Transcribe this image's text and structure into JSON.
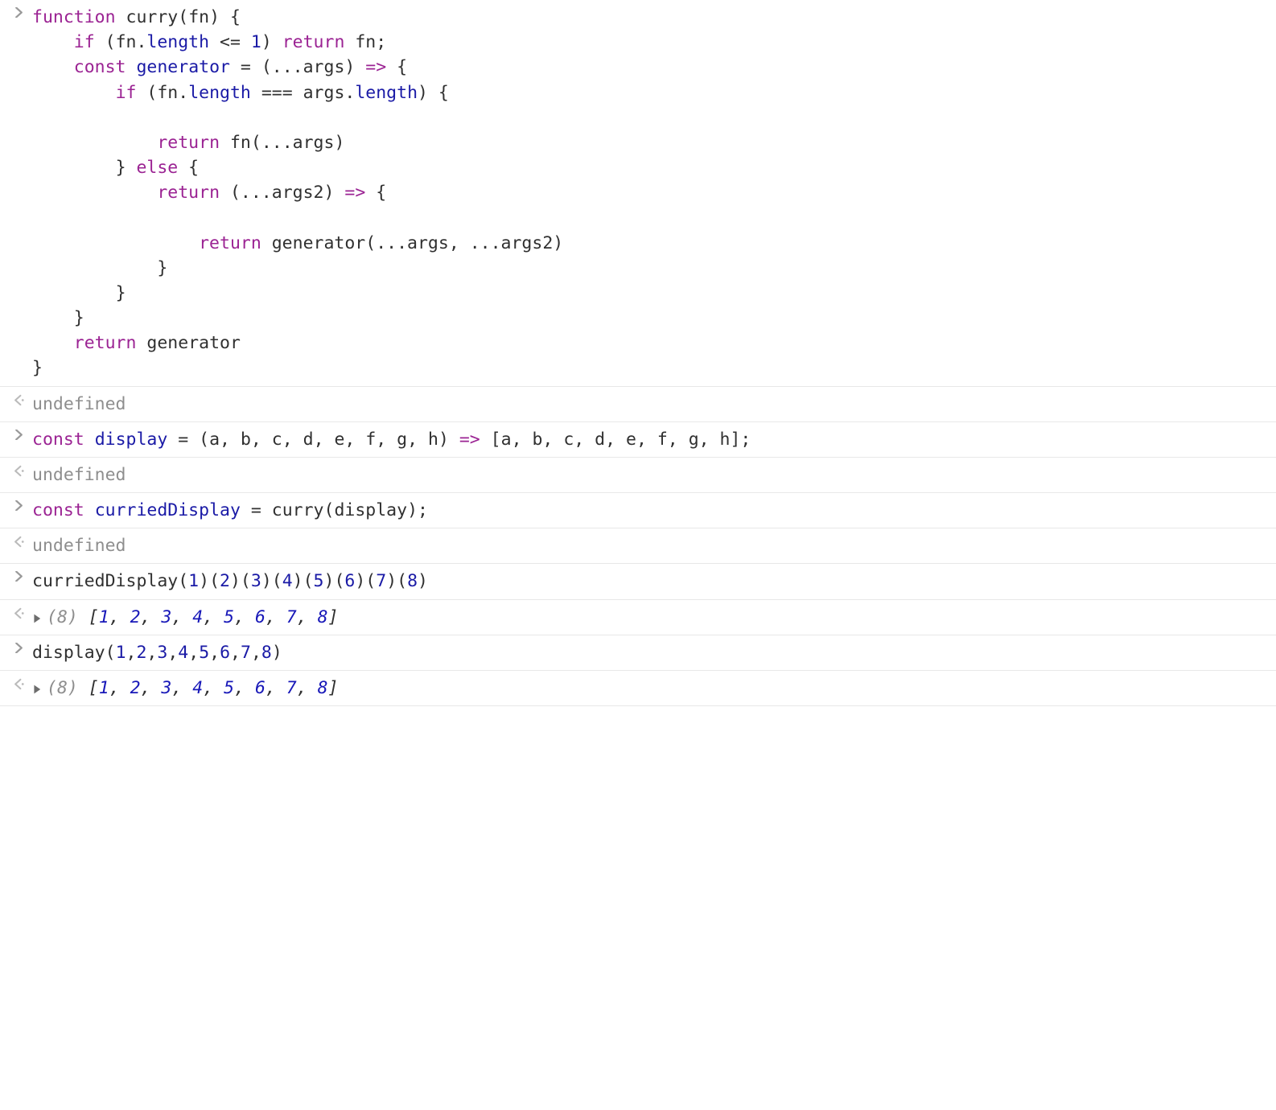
{
  "colors": {
    "keyword": "#9b2393",
    "identifier": "#303030",
    "declared": "#1a1aa6",
    "property": "#1a1aa6",
    "number": "#1a1aa6",
    "undefined": "#8e8e8e"
  },
  "entries": [
    {
      "type": "input",
      "tokens": [
        {
          "t": "kw",
          "v": "function"
        },
        {
          "t": "punc",
          "v": " "
        },
        {
          "t": "fname",
          "v": "curry"
        },
        {
          "t": "punc",
          "v": "("
        },
        {
          "t": "ident",
          "v": "fn"
        },
        {
          "t": "punc",
          "v": ") {"
        },
        {
          "t": "nl"
        },
        {
          "t": "punc",
          "v": "    "
        },
        {
          "t": "kw",
          "v": "if"
        },
        {
          "t": "punc",
          "v": " ("
        },
        {
          "t": "ident",
          "v": "fn"
        },
        {
          "t": "punc",
          "v": "."
        },
        {
          "t": "prop",
          "v": "length"
        },
        {
          "t": "punc",
          "v": " "
        },
        {
          "t": "op",
          "v": "<="
        },
        {
          "t": "punc",
          "v": " "
        },
        {
          "t": "num",
          "v": "1"
        },
        {
          "t": "punc",
          "v": ") "
        },
        {
          "t": "kw",
          "v": "return"
        },
        {
          "t": "punc",
          "v": " "
        },
        {
          "t": "ident",
          "v": "fn"
        },
        {
          "t": "punc",
          "v": ";"
        },
        {
          "t": "nl"
        },
        {
          "t": "punc",
          "v": "    "
        },
        {
          "t": "kw",
          "v": "const"
        },
        {
          "t": "punc",
          "v": " "
        },
        {
          "t": "decl",
          "v": "generator"
        },
        {
          "t": "punc",
          "v": " "
        },
        {
          "t": "op",
          "v": "="
        },
        {
          "t": "punc",
          "v": " ("
        },
        {
          "t": "spread",
          "v": "..."
        },
        {
          "t": "ident",
          "v": "args"
        },
        {
          "t": "punc",
          "v": ") "
        },
        {
          "t": "arrow",
          "v": "=>"
        },
        {
          "t": "punc",
          "v": " {"
        },
        {
          "t": "nl"
        },
        {
          "t": "punc",
          "v": "        "
        },
        {
          "t": "kw",
          "v": "if"
        },
        {
          "t": "punc",
          "v": " ("
        },
        {
          "t": "ident",
          "v": "fn"
        },
        {
          "t": "punc",
          "v": "."
        },
        {
          "t": "prop",
          "v": "length"
        },
        {
          "t": "punc",
          "v": " "
        },
        {
          "t": "op",
          "v": "==="
        },
        {
          "t": "punc",
          "v": " "
        },
        {
          "t": "ident",
          "v": "args"
        },
        {
          "t": "punc",
          "v": "."
        },
        {
          "t": "prop",
          "v": "length"
        },
        {
          "t": "punc",
          "v": ") {"
        },
        {
          "t": "nl"
        },
        {
          "t": "nl"
        },
        {
          "t": "punc",
          "v": "            "
        },
        {
          "t": "kw",
          "v": "return"
        },
        {
          "t": "punc",
          "v": " "
        },
        {
          "t": "ident",
          "v": "fn"
        },
        {
          "t": "punc",
          "v": "("
        },
        {
          "t": "spread",
          "v": "..."
        },
        {
          "t": "ident",
          "v": "args"
        },
        {
          "t": "punc",
          "v": ")"
        },
        {
          "t": "nl"
        },
        {
          "t": "punc",
          "v": "        } "
        },
        {
          "t": "kw",
          "v": "else"
        },
        {
          "t": "punc",
          "v": " {"
        },
        {
          "t": "nl"
        },
        {
          "t": "punc",
          "v": "            "
        },
        {
          "t": "kw",
          "v": "return"
        },
        {
          "t": "punc",
          "v": " ("
        },
        {
          "t": "spread",
          "v": "..."
        },
        {
          "t": "ident",
          "v": "args2"
        },
        {
          "t": "punc",
          "v": ") "
        },
        {
          "t": "arrow",
          "v": "=>"
        },
        {
          "t": "punc",
          "v": " {"
        },
        {
          "t": "nl"
        },
        {
          "t": "nl"
        },
        {
          "t": "punc",
          "v": "                "
        },
        {
          "t": "kw",
          "v": "return"
        },
        {
          "t": "punc",
          "v": " "
        },
        {
          "t": "ident",
          "v": "generator"
        },
        {
          "t": "punc",
          "v": "("
        },
        {
          "t": "spread",
          "v": "..."
        },
        {
          "t": "ident",
          "v": "args"
        },
        {
          "t": "punc",
          "v": ", "
        },
        {
          "t": "spread",
          "v": "..."
        },
        {
          "t": "ident",
          "v": "args2"
        },
        {
          "t": "punc",
          "v": ")"
        },
        {
          "t": "nl"
        },
        {
          "t": "punc",
          "v": "            }"
        },
        {
          "t": "nl"
        },
        {
          "t": "punc",
          "v": "        }"
        },
        {
          "t": "nl"
        },
        {
          "t": "punc",
          "v": "    }"
        },
        {
          "t": "nl"
        },
        {
          "t": "punc",
          "v": "    "
        },
        {
          "t": "kw",
          "v": "return"
        },
        {
          "t": "punc",
          "v": " "
        },
        {
          "t": "ident",
          "v": "generator"
        },
        {
          "t": "nl"
        },
        {
          "t": "punc",
          "v": "}"
        }
      ]
    },
    {
      "type": "result",
      "undefined": true,
      "text": "undefined"
    },
    {
      "type": "input",
      "tokens": [
        {
          "t": "kw",
          "v": "const"
        },
        {
          "t": "punc",
          "v": " "
        },
        {
          "t": "decl",
          "v": "display"
        },
        {
          "t": "punc",
          "v": " "
        },
        {
          "t": "op",
          "v": "="
        },
        {
          "t": "punc",
          "v": " ("
        },
        {
          "t": "ident",
          "v": "a"
        },
        {
          "t": "punc",
          "v": ", "
        },
        {
          "t": "ident",
          "v": "b"
        },
        {
          "t": "punc",
          "v": ", "
        },
        {
          "t": "ident",
          "v": "c"
        },
        {
          "t": "punc",
          "v": ", "
        },
        {
          "t": "ident",
          "v": "d"
        },
        {
          "t": "punc",
          "v": ", "
        },
        {
          "t": "ident",
          "v": "e"
        },
        {
          "t": "punc",
          "v": ", "
        },
        {
          "t": "ident",
          "v": "f"
        },
        {
          "t": "punc",
          "v": ", "
        },
        {
          "t": "ident",
          "v": "g"
        },
        {
          "t": "punc",
          "v": ", "
        },
        {
          "t": "ident",
          "v": "h"
        },
        {
          "t": "punc",
          "v": ") "
        },
        {
          "t": "arrow",
          "v": "=>"
        },
        {
          "t": "punc",
          "v": " ["
        },
        {
          "t": "ident",
          "v": "a"
        },
        {
          "t": "punc",
          "v": ", "
        },
        {
          "t": "ident",
          "v": "b"
        },
        {
          "t": "punc",
          "v": ", "
        },
        {
          "t": "ident",
          "v": "c"
        },
        {
          "t": "punc",
          "v": ", "
        },
        {
          "t": "ident",
          "v": "d"
        },
        {
          "t": "punc",
          "v": ", "
        },
        {
          "t": "ident",
          "v": "e"
        },
        {
          "t": "punc",
          "v": ", "
        },
        {
          "t": "ident",
          "v": "f"
        },
        {
          "t": "punc",
          "v": ", "
        },
        {
          "t": "ident",
          "v": "g"
        },
        {
          "t": "punc",
          "v": ", "
        },
        {
          "t": "ident",
          "v": "h"
        },
        {
          "t": "punc",
          "v": "];"
        }
      ]
    },
    {
      "type": "result",
      "undefined": true,
      "text": "undefined"
    },
    {
      "type": "input",
      "tokens": [
        {
          "t": "kw",
          "v": "const"
        },
        {
          "t": "punc",
          "v": " "
        },
        {
          "t": "decl",
          "v": "curriedDisplay"
        },
        {
          "t": "punc",
          "v": " "
        },
        {
          "t": "op",
          "v": "="
        },
        {
          "t": "punc",
          "v": " "
        },
        {
          "t": "ident",
          "v": "curry"
        },
        {
          "t": "punc",
          "v": "("
        },
        {
          "t": "ident",
          "v": "display"
        },
        {
          "t": "punc",
          "v": ");"
        }
      ]
    },
    {
      "type": "result",
      "undefined": true,
      "text": "undefined"
    },
    {
      "type": "input",
      "tokens": [
        {
          "t": "ident",
          "v": "curriedDisplay"
        },
        {
          "t": "punc",
          "v": "("
        },
        {
          "t": "num",
          "v": "1"
        },
        {
          "t": "punc",
          "v": ")("
        },
        {
          "t": "num",
          "v": "2"
        },
        {
          "t": "punc",
          "v": ")("
        },
        {
          "t": "num",
          "v": "3"
        },
        {
          "t": "punc",
          "v": ")("
        },
        {
          "t": "num",
          "v": "4"
        },
        {
          "t": "punc",
          "v": ")("
        },
        {
          "t": "num",
          "v": "5"
        },
        {
          "t": "punc",
          "v": ")("
        },
        {
          "t": "num",
          "v": "6"
        },
        {
          "t": "punc",
          "v": ")("
        },
        {
          "t": "num",
          "v": "7"
        },
        {
          "t": "punc",
          "v": ")("
        },
        {
          "t": "num",
          "v": "8"
        },
        {
          "t": "punc",
          "v": ")"
        }
      ]
    },
    {
      "type": "result",
      "array": {
        "length": 8,
        "values": [
          1,
          2,
          3,
          4,
          5,
          6,
          7,
          8
        ]
      }
    },
    {
      "type": "input",
      "tokens": [
        {
          "t": "ident",
          "v": "display"
        },
        {
          "t": "punc",
          "v": "("
        },
        {
          "t": "num",
          "v": "1"
        },
        {
          "t": "punc",
          "v": ","
        },
        {
          "t": "num",
          "v": "2"
        },
        {
          "t": "punc",
          "v": ","
        },
        {
          "t": "num",
          "v": "3"
        },
        {
          "t": "punc",
          "v": ","
        },
        {
          "t": "num",
          "v": "4"
        },
        {
          "t": "punc",
          "v": ","
        },
        {
          "t": "num",
          "v": "5"
        },
        {
          "t": "punc",
          "v": ","
        },
        {
          "t": "num",
          "v": "6"
        },
        {
          "t": "punc",
          "v": ","
        },
        {
          "t": "num",
          "v": "7"
        },
        {
          "t": "punc",
          "v": ","
        },
        {
          "t": "num",
          "v": "8"
        },
        {
          "t": "punc",
          "v": ")"
        }
      ]
    },
    {
      "type": "result",
      "array": {
        "length": 8,
        "values": [
          1,
          2,
          3,
          4,
          5,
          6,
          7,
          8
        ]
      }
    }
  ]
}
